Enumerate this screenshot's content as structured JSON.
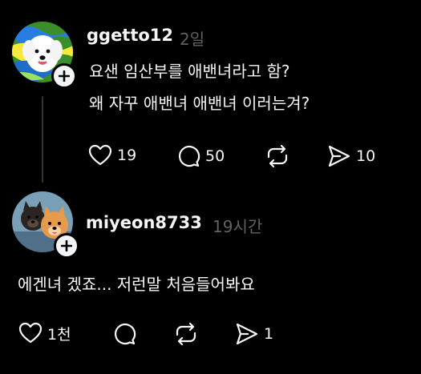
{
  "comments": [
    {
      "username": "ggetto12",
      "time": "2일",
      "lines": [
        "요샌 임산부를 애밴녀라고 함?",
        "왜 자꾸 애밴녀 애밴녀 이러는겨?"
      ],
      "likes": "19",
      "replies": "50",
      "reposts": "",
      "shares": "10",
      "avatar_icon": "white-dog-psychedelic-avatar"
    },
    {
      "username": "miyeon8733",
      "time": "19시간",
      "lines": [
        "에겐녀 겠죠... 저런말 처음들어봐요"
      ],
      "likes": "1천",
      "replies": "",
      "reposts": "",
      "shares": "1",
      "avatar_icon": "two-pomeranians-avatar"
    }
  ],
  "icons": [
    "heart-icon",
    "comment-icon",
    "repost-icon",
    "share-icon",
    "plus-icon"
  ],
  "colors": {
    "background": "#000000",
    "text": "#f3f5f7",
    "muted": "#616161",
    "thread_line": "#333638"
  }
}
